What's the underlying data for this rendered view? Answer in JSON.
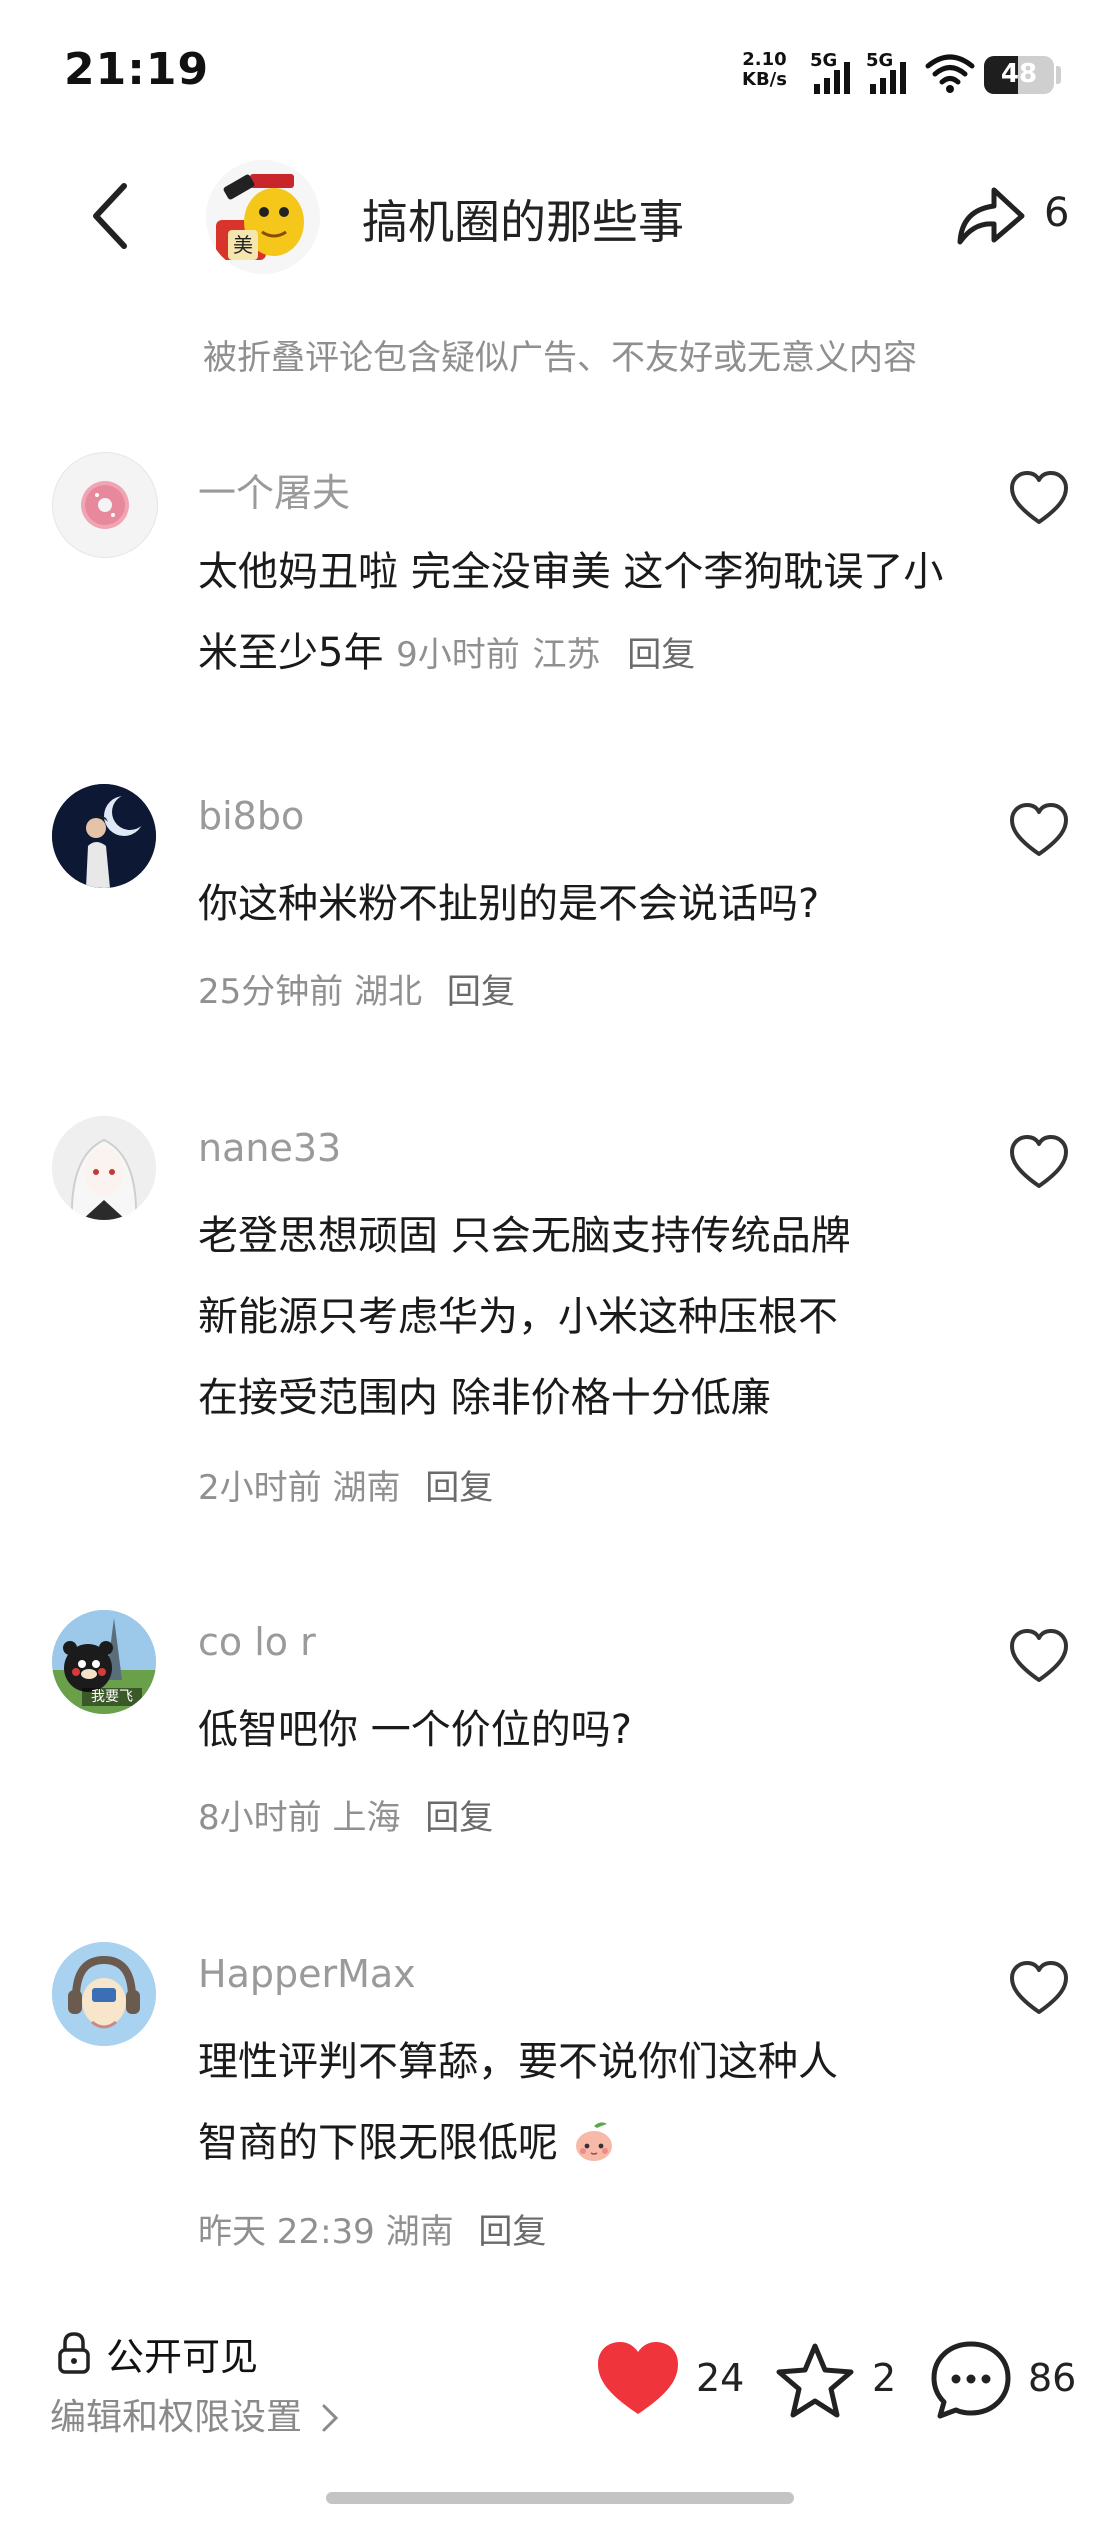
{
  "status_bar": {
    "time": "21:19",
    "net_speed_value": "2.10",
    "net_speed_unit": "KB/s",
    "sim1": "5G",
    "sim2": "5G",
    "battery": "48",
    "battery_level": 0.48
  },
  "header": {
    "title": "搞机圈的那些事",
    "share_count": "6",
    "fold_notice": "被折叠评论包含疑似广告、不友好或无意义内容",
    "avatar_badge": "美"
  },
  "comments": [
    {
      "username": "一个屠夫",
      "text": "太他妈丑啦 完全没审美 这个李狗耽误了小米至少5年",
      "time": "9小时前",
      "location": "江苏",
      "reply": "回复"
    },
    {
      "username": "bi8bo",
      "text": "你这种米粉不扯别的是不会说话吗?",
      "time": "25分钟前",
      "location": "湖北",
      "reply": "回复"
    },
    {
      "username": "nane33",
      "text_lines": [
        "老登思想顽固 只会无脑支持传统品牌",
        "新能源只考虑华为，小米这种压根不",
        "在接受范围内 除非价格十分低廉"
      ],
      "time": "2小时前",
      "location": "湖南",
      "reply": "回复"
    },
    {
      "username": "co lo r",
      "text": "低智吧你 一个价位的吗?",
      "time": "8小时前",
      "location": "上海",
      "reply": "回复",
      "avatar_caption": "我要飞"
    },
    {
      "username": "HapperMax",
      "text_lines": [
        "理性评判不算舔，要不说你们这种人",
        "智商的下限无限低呢"
      ],
      "time": "昨天 22:39",
      "location": "湖南",
      "reply": "回复"
    }
  ],
  "bottom_bar": {
    "visibility": "公开可见",
    "permissions_link": "编辑和权限设置",
    "like_count": "24",
    "favorite_count": "2",
    "comment_count": "86"
  },
  "colors": {
    "like_red": "#f0343c",
    "muted_text": "#9a9a9a",
    "body_text": "#1a1a1a"
  }
}
